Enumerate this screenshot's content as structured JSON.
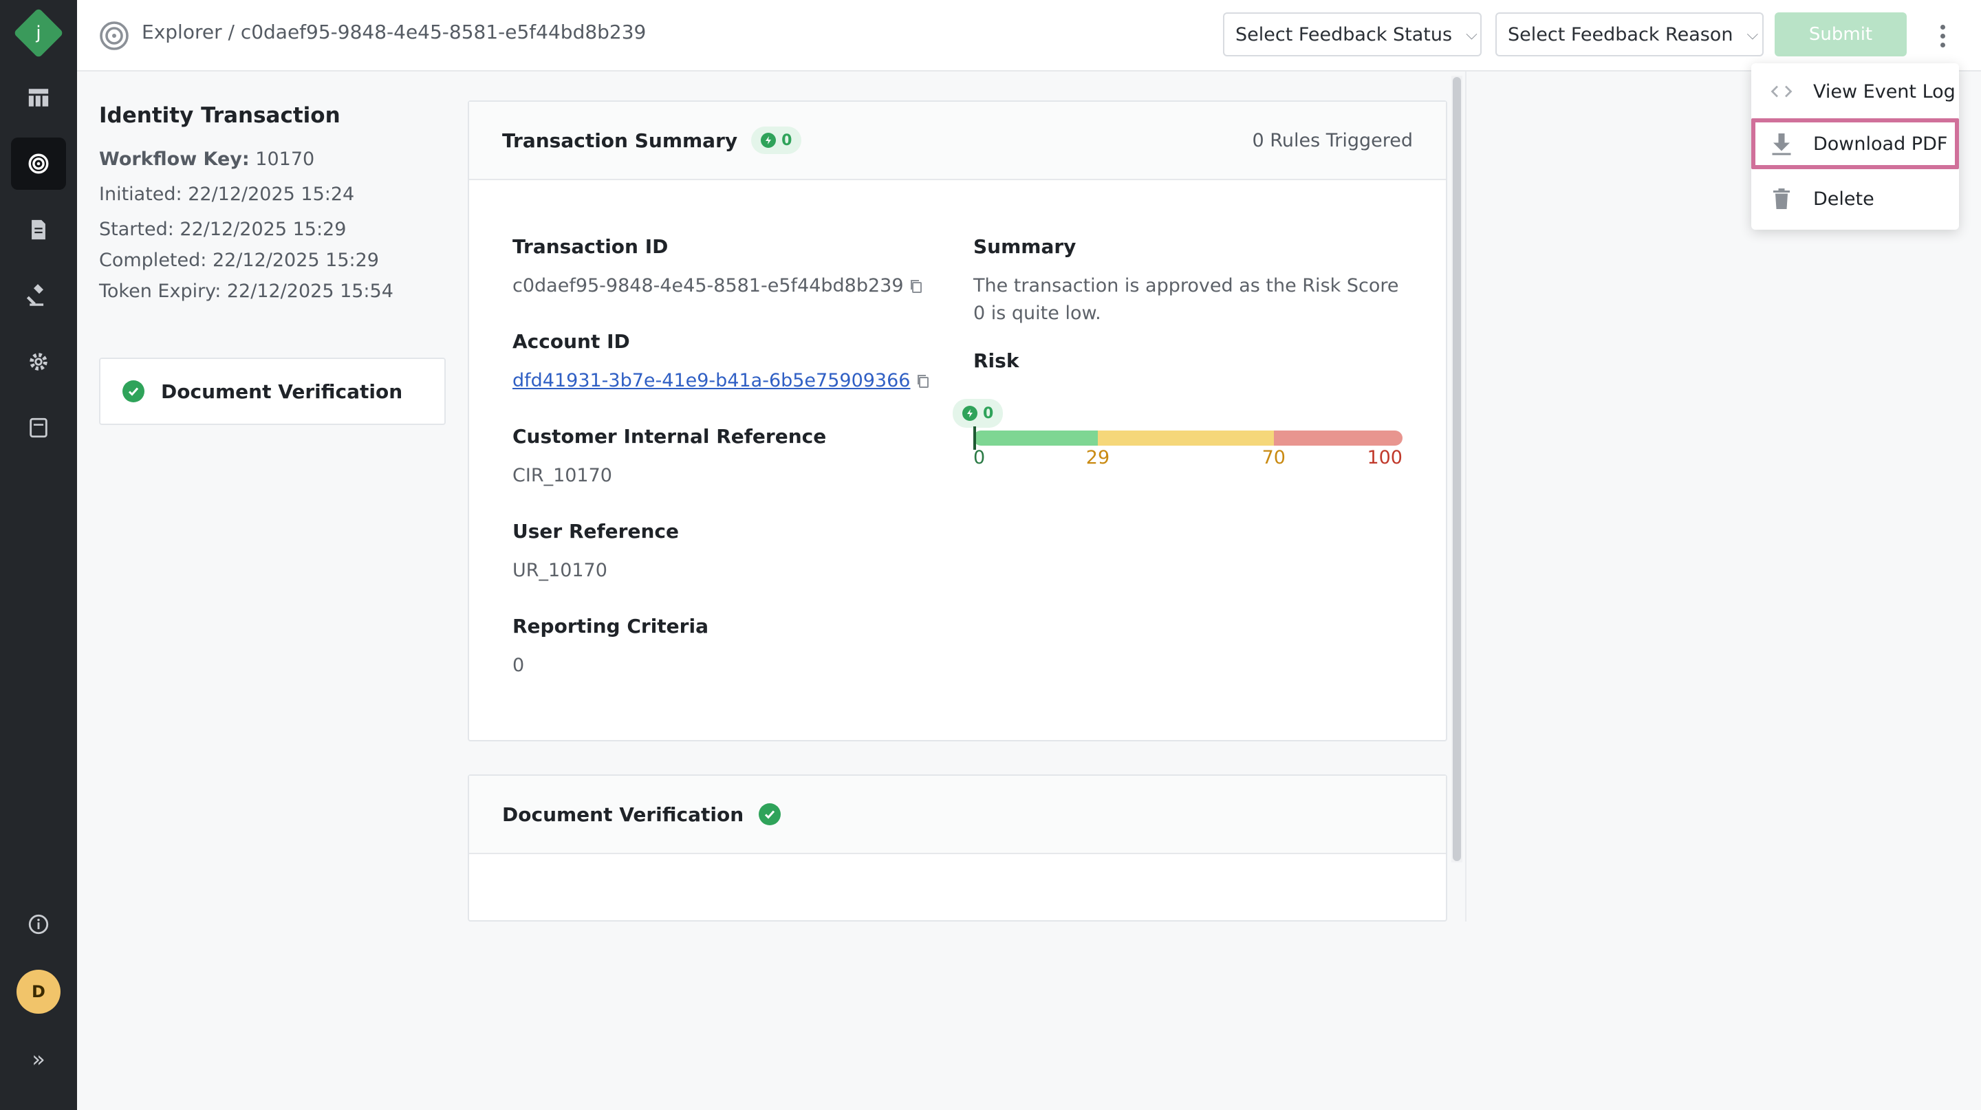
{
  "app": {
    "logo_letter": "j",
    "user_initial": "D",
    "expand_glyph": "»"
  },
  "colors": {
    "rail_bg": "#24272b",
    "accent_green": "#2fa35a",
    "link_blue": "#2f5fc4",
    "risk_low": "#7ed693",
    "risk_mid": "#f5d77a",
    "risk_high": "#e8958f",
    "highlight": "#d0709a"
  },
  "sidebar": {
    "items": [
      {
        "icon": "table-icon"
      },
      {
        "icon": "explorer-icon",
        "active": true
      },
      {
        "icon": "document-icon"
      },
      {
        "icon": "gavel-icon"
      },
      {
        "icon": "gear-icon"
      },
      {
        "icon": "notebook-icon"
      },
      {
        "icon": "info-icon"
      }
    ]
  },
  "header": {
    "breadcrumb": "Explorer / c0daef95-9848-4e45-8581-e5f44bd8b239",
    "feedback_status_label": "Select Feedback Status",
    "feedback_reason_label": "Select Feedback Reason",
    "submit_label": "Submit"
  },
  "menu": {
    "items": [
      {
        "label": "View Event Log",
        "icon": "code-icon"
      },
      {
        "label": "Download PDF",
        "icon": "download-icon",
        "highlighted": true
      },
      {
        "label": "Delete",
        "icon": "trash-icon"
      }
    ]
  },
  "info": {
    "title": "Identity Transaction",
    "workflow_key_label": "Workflow Key:",
    "workflow_key_value": "10170",
    "initiated": "Initiated: 22/12/2025 15:24",
    "started": "Started: 22/12/2025 15:29",
    "completed": "Completed: 22/12/2025 15:29",
    "token_expiry": "Token Expiry: 22/12/2025 15:54",
    "step_card_label": "Document Verification"
  },
  "summary_card": {
    "title": "Transaction Summary",
    "badge_count": "0",
    "rules_triggered": "0 Rules Triggered",
    "fields": {
      "transaction_id_label": "Transaction ID",
      "transaction_id_value": "c0daef95-9848-4e45-8581-e5f44bd8b239",
      "account_id_label": "Account ID",
      "account_id_value": "dfd41931-3b7e-41e9-b41a-6b5e75909366",
      "cir_label": "Customer Internal Reference",
      "cir_value": "CIR_10170",
      "user_ref_label": "User Reference",
      "user_ref_value": "UR_10170",
      "reporting_label": "Reporting Criteria",
      "reporting_value": "0",
      "summary_label": "Summary",
      "summary_value": "The transaction is approved as the Risk Score 0 is quite low.",
      "risk_label": "Risk"
    },
    "risk": {
      "score": 0,
      "score_label": "0",
      "max": 100,
      "ticks": [
        "0",
        "29",
        "70",
        "100"
      ],
      "tick_values": [
        0,
        29,
        70,
        100
      ]
    }
  },
  "doc_card": {
    "title": "Document Verification"
  }
}
